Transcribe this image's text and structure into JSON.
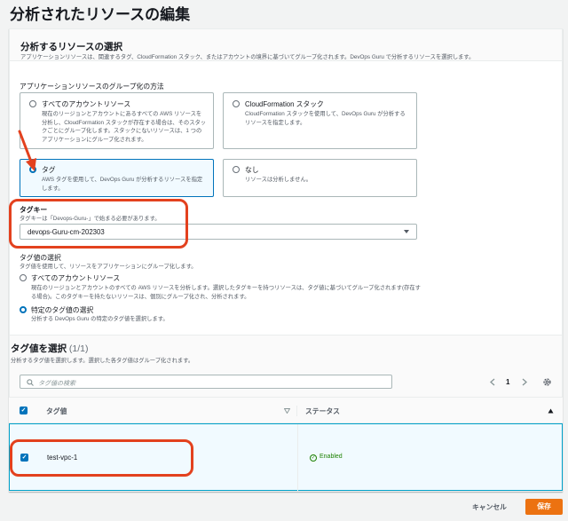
{
  "page": {
    "title": "分析されたリソースの編集"
  },
  "section": {
    "title": "分析するリソースの選択",
    "description": "アプリケーションリソースは、関連するタグ、CloudFormation スタック、またはアカウントの境界に基づいてグループ化されます。DevOps Guru で分析するリソースを選択します。"
  },
  "grouping": {
    "label": "アプリケーションリソースのグループ化の方法",
    "options": [
      {
        "title": "すべてのアカウントリソース",
        "desc": "現在のリージョンとアカウントにあるすべての AWS リソースを分析し、CloudFormation スタックが存在する場合は、そのスタックごとにグループ化します。スタックにないリソースは、1 つのアプリケーションにグループ化されます。",
        "selected": false
      },
      {
        "title": "CloudFormation スタック",
        "desc": "CloudFormation スタックを使用して、DevOps Guru が分析するリソースを指定します。",
        "selected": false
      },
      {
        "title": "タグ",
        "desc": "AWS タグを使用して、DevOps Guru が分析するリソースを指定します。",
        "selected": true
      },
      {
        "title": "なし",
        "desc": "リソースは分析しません。",
        "selected": false
      }
    ]
  },
  "tag_key": {
    "label": "タグキー",
    "hint": "タグキーは「Devops-Guru-」で始まる必要があります。",
    "value": "devops-Guru-cm-202303"
  },
  "tag_values": {
    "label": "タグ値の選択",
    "hint": "タグ値を使用して、リソースをアプリケーションにグループ化します。",
    "options": [
      {
        "title": "すべてのアカウントリソース",
        "desc": "現在のリージョンとアカウントのすべての AWS リソースを分析します。選択したタグキーを持つリソースは、タグ値に基づいてグループ化されます(存在する場合)。このタグキーを持たないリソースは、個別にグループ化され、分析されます。",
        "selected": false
      },
      {
        "title": "特定のタグ値の選択",
        "desc": "分析する DevOps Guru の特定のタグ値を選択します。",
        "selected": true
      }
    ]
  },
  "table": {
    "title": "タグ値を選択",
    "count": "(1/1)",
    "description": "分析するタグ値を選択します。選択した各タグ値はグループ化されます。",
    "search_placeholder": "タグ値の検索",
    "page_number": "1",
    "columns": [
      "タグ値",
      "ステータス"
    ],
    "rows": [
      {
        "value": "test-vpc-1",
        "status": "Enabled",
        "checked": true
      }
    ]
  },
  "footer": {
    "cancel_label": "キャンセル",
    "save_label": "保存"
  },
  "colors": {
    "accent": "#0073bb",
    "primary_button": "#ec7211",
    "success": "#1d8102",
    "annotation": "#e3411e"
  }
}
